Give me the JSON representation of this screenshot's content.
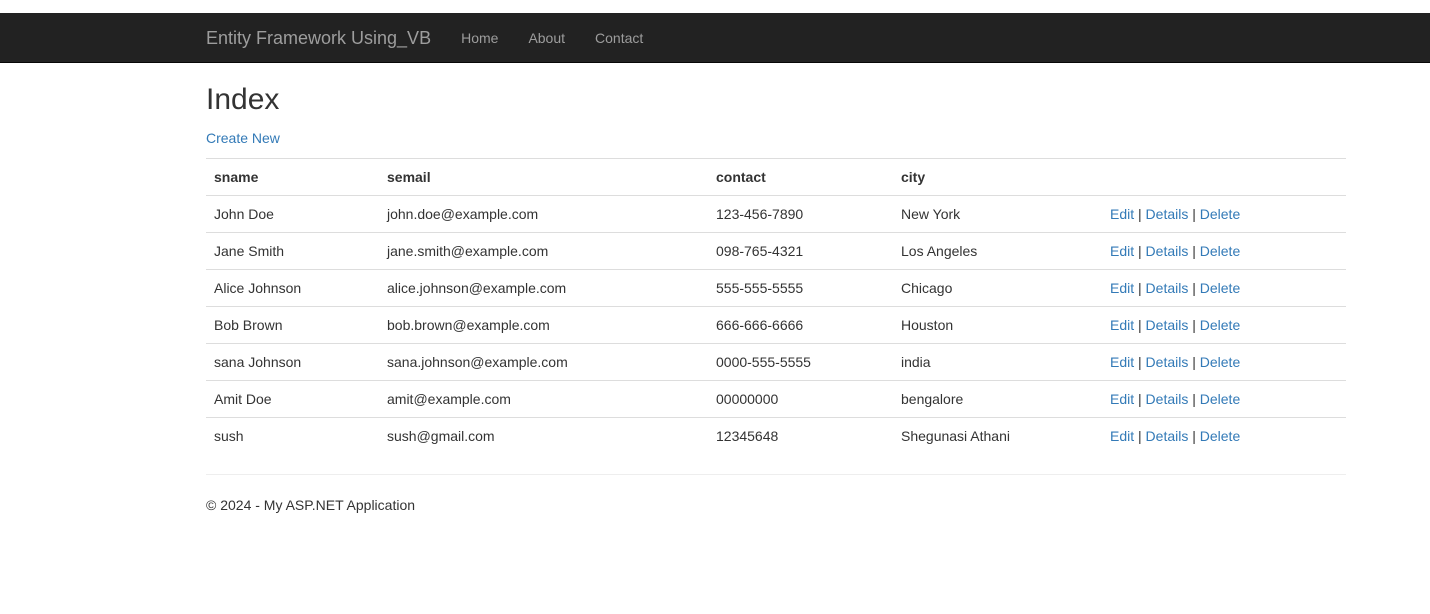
{
  "navbar": {
    "brand": "Entity Framework Using_VB",
    "links": [
      {
        "label": "Home"
      },
      {
        "label": "About"
      },
      {
        "label": "Contact"
      }
    ]
  },
  "page": {
    "title": "Index",
    "create_link": "Create New"
  },
  "table": {
    "columns": [
      "sname",
      "semail",
      "contact",
      "city",
      ""
    ],
    "rows": [
      {
        "sname": "John Doe",
        "semail": "john.doe@example.com",
        "contact": "123-456-7890",
        "city": "New York"
      },
      {
        "sname": "Jane Smith",
        "semail": "jane.smith@example.com",
        "contact": "098-765-4321",
        "city": "Los Angeles"
      },
      {
        "sname": "Alice Johnson",
        "semail": "alice.johnson@example.com",
        "contact": "555-555-5555",
        "city": "Chicago"
      },
      {
        "sname": "Bob Brown",
        "semail": "bob.brown@example.com",
        "contact": "666-666-6666",
        "city": "Houston"
      },
      {
        "sname": "sana Johnson",
        "semail": "sana.johnson@example.com",
        "contact": "0000-555-5555",
        "city": "india"
      },
      {
        "sname": "Amit Doe",
        "semail": "amit@example.com",
        "contact": "00000000",
        "city": "bengalore"
      },
      {
        "sname": "sush",
        "semail": "sush@gmail.com",
        "contact": "12345648",
        "city": "Shegunasi Athani"
      }
    ],
    "actions": {
      "edit": "Edit",
      "details": "Details",
      "delete": "Delete",
      "separator": "|"
    }
  },
  "footer": {
    "text": "© 2024 - My ASP.NET Application"
  },
  "colors": {
    "navbar_bg": "#222222",
    "link": "#337ab7",
    "nav_text": "#9d9d9d"
  }
}
